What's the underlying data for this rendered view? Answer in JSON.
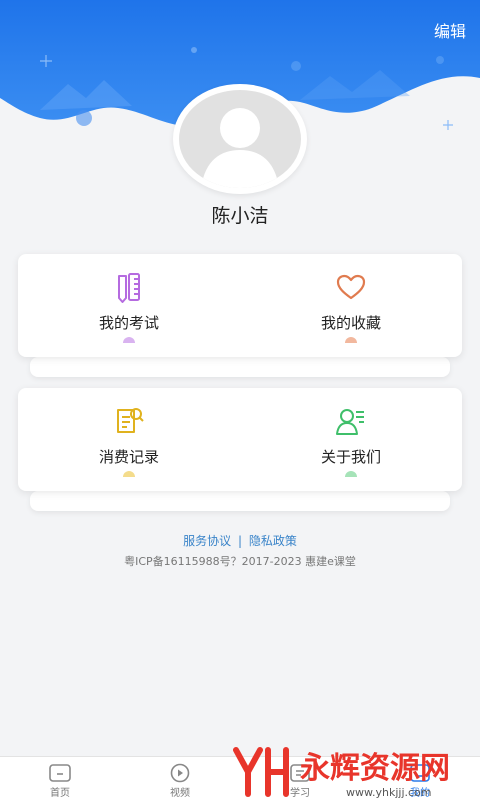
{
  "header": {
    "edit_label": "编辑"
  },
  "profile": {
    "name": "陈小洁"
  },
  "cards": [
    {
      "items": [
        {
          "label": "我的考试",
          "icon": "exam-icon",
          "color": "#b56be0"
        },
        {
          "label": "我的收藏",
          "icon": "heart-icon",
          "color": "#e07b4f"
        }
      ]
    },
    {
      "items": [
        {
          "label": "消费记录",
          "icon": "receipt-icon",
          "color": "#e0b21e"
        },
        {
          "label": "关于我们",
          "icon": "user-card-icon",
          "color": "#3fbf6a"
        }
      ]
    }
  ],
  "footer": {
    "service_agreement": "服务协议",
    "separator": "|",
    "privacy_policy": "隐私政策",
    "icp": "粤ICP备16115988号？2017-2023 惠建e课堂"
  },
  "tabbar": [
    {
      "label": "首页",
      "icon": "home-icon"
    },
    {
      "label": "视频",
      "icon": "play-icon"
    },
    {
      "label": "学习",
      "icon": "study-icon"
    },
    {
      "label": "我的",
      "icon": "profile-icon",
      "active": true
    }
  ],
  "watermark": {
    "text": "永辉资源网",
    "url": "www.yhkjjj.com"
  },
  "colors": {
    "brand": "#2b7be8",
    "background": "#f3f4f6"
  }
}
